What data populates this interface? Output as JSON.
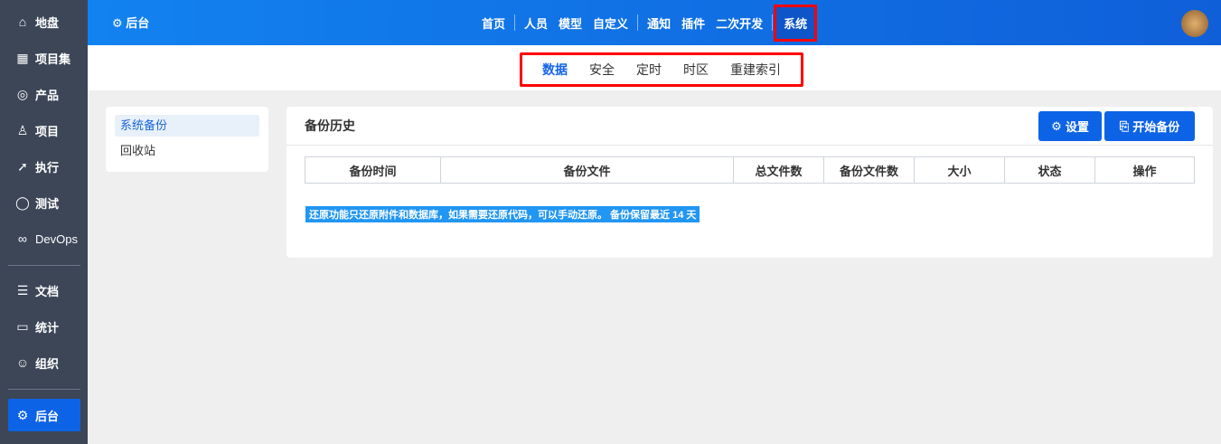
{
  "sidebar": {
    "items": [
      {
        "label": "地盘",
        "icon": "home-icon"
      },
      {
        "label": "项目集",
        "icon": "grid-icon"
      },
      {
        "label": "产品",
        "icon": "lightbulb-icon"
      },
      {
        "label": "项目",
        "icon": "rocket-icon"
      },
      {
        "label": "执行",
        "icon": "run-icon"
      },
      {
        "label": "测试",
        "icon": "search-icon"
      },
      {
        "label": "DevOps",
        "icon": "infinity-icon"
      },
      {
        "label": "文档",
        "icon": "doc-icon"
      },
      {
        "label": "统计",
        "icon": "chart-icon"
      },
      {
        "label": "组织",
        "icon": "users-icon"
      },
      {
        "label": "后台",
        "icon": "gear-icon"
      }
    ]
  },
  "header": {
    "title": "后台",
    "nav": [
      "首页",
      "人员",
      "模型",
      "自定义",
      "通知",
      "插件",
      "二次开发",
      "系统"
    ]
  },
  "subtabs": [
    "数据",
    "安全",
    "定时",
    "时区",
    "重建索引"
  ],
  "left_menu": [
    "系统备份",
    "回收站"
  ],
  "main": {
    "title": "备份历史",
    "settings_label": "设置",
    "start_label": "开始备份",
    "columns": [
      "备份时间",
      "备份文件",
      "总文件数",
      "备份文件数",
      "大小",
      "状态",
      "操作"
    ],
    "note": "还原功能只还原附件和数据库，如果需要还原代码，可以手动还原。 备份保留最近 14 天"
  }
}
